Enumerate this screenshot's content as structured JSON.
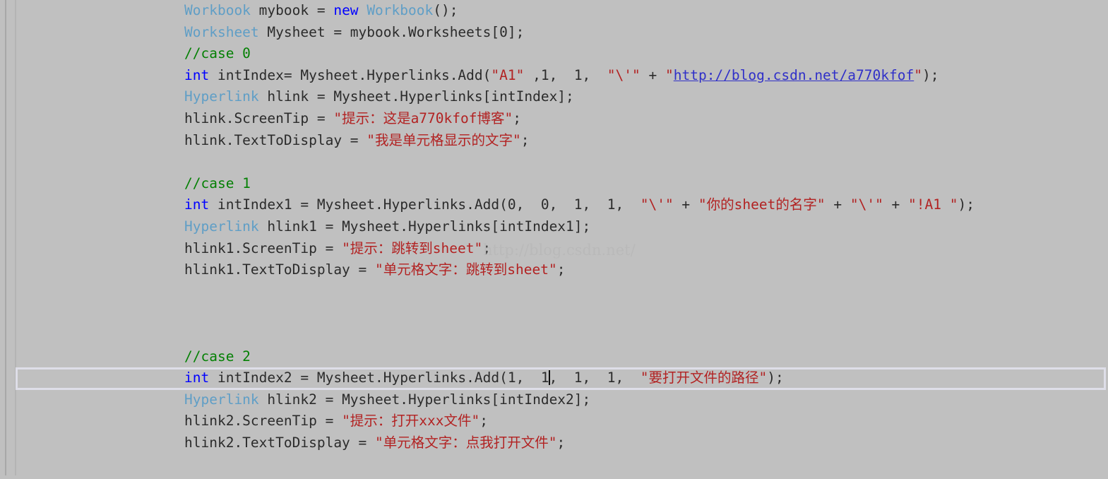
{
  "editor": {
    "background_color": "#c0c0c0",
    "font_size_px": 19.5,
    "watermark": "http://blog.csdn.net/",
    "caret_visible": true,
    "colors": {
      "type": "#5f9ec6",
      "keyword": "#0000ff",
      "comment": "#048004",
      "string": "#b22222",
      "plain": "#2b2b2b",
      "hyperlink": "#3030c8",
      "highlight_border": "#dedee8"
    }
  },
  "code": {
    "lines": [
      {
        "id": 1,
        "text": "Workbook mybook = new Workbook();",
        "tokens": [
          {
            "t": "Workbook",
            "c": "type"
          },
          {
            "t": " mybook = ",
            "c": "plain"
          },
          {
            "t": "new",
            "c": "keyword"
          },
          {
            "t": " ",
            "c": "plain"
          },
          {
            "t": "Workbook",
            "c": "type"
          },
          {
            "t": "();",
            "c": "plain"
          }
        ]
      },
      {
        "id": 2,
        "text": "Worksheet Mysheet = mybook.Worksheets[0];",
        "tokens": [
          {
            "t": "Worksheet",
            "c": "type"
          },
          {
            "t": " Mysheet = mybook.Worksheets[0];",
            "c": "plain"
          }
        ]
      },
      {
        "id": 3,
        "text": "//case 0",
        "tokens": [
          {
            "t": "//case 0",
            "c": "comment"
          }
        ]
      },
      {
        "id": 4,
        "text": "int intIndex= Mysheet.Hyperlinks.Add(\"A1\" ,1, 1, \"\\'\" + \"http://blog.csdn.net/a770kfof\");",
        "tokens": [
          {
            "t": "int",
            "c": "keyword"
          },
          {
            "t": " intIndex= Mysheet.Hyperlinks.Add(",
            "c": "plain"
          },
          {
            "t": "\"A1\"",
            "c": "string"
          },
          {
            "t": " ,1,  1,  ",
            "c": "plain"
          },
          {
            "t": "\"\\'\"",
            "c": "string"
          },
          {
            "t": " + ",
            "c": "plain"
          },
          {
            "t": "\"",
            "c": "string"
          },
          {
            "t": "http://blog.csdn.net/a770kfof",
            "c": "hyperlink"
          },
          {
            "t": "\"",
            "c": "string"
          },
          {
            "t": ");",
            "c": "plain"
          }
        ]
      },
      {
        "id": 5,
        "text": "Hyperlink hlink = Mysheet.Hyperlinks[intIndex];",
        "tokens": [
          {
            "t": "Hyperlink",
            "c": "type"
          },
          {
            "t": " hlink = Mysheet.Hyperlinks[intIndex];",
            "c": "plain"
          }
        ]
      },
      {
        "id": 6,
        "text": "hlink.ScreenTip = \"提示：这是a770kfof博客\";",
        "tokens": [
          {
            "t": "hlink.ScreenTip = ",
            "c": "plain"
          },
          {
            "t": "\"提示：这是a770kfof博客\"",
            "c": "string"
          },
          {
            "t": ";",
            "c": "plain"
          }
        ]
      },
      {
        "id": 7,
        "text": "hlink.TextToDisplay = \"我是单元格显示的文字\";",
        "tokens": [
          {
            "t": "hlink.TextToDisplay = ",
            "c": "plain"
          },
          {
            "t": "\"我是单元格显示的文字\"",
            "c": "string"
          },
          {
            "t": ";",
            "c": "plain"
          }
        ]
      },
      {
        "id": 8,
        "text": "",
        "tokens": []
      },
      {
        "id": 9,
        "text": "//case 1",
        "tokens": [
          {
            "t": "//case 1",
            "c": "comment"
          }
        ]
      },
      {
        "id": 10,
        "text": "int intIndex1 = Mysheet.Hyperlinks.Add(0, 0, 1, 1, \"\\'\" + \"你的sheet的名字\" + \"\\'\" + \"!A1 \");",
        "tokens": [
          {
            "t": "int",
            "c": "keyword"
          },
          {
            "t": " intIndex1 = Mysheet.Hyperlinks.Add(0,  0,  1,  1,  ",
            "c": "plain"
          },
          {
            "t": "\"\\'\"",
            "c": "string"
          },
          {
            "t": " + ",
            "c": "plain"
          },
          {
            "t": "\"你的sheet的名字\"",
            "c": "string"
          },
          {
            "t": " + ",
            "c": "plain"
          },
          {
            "t": "\"\\'\"",
            "c": "string"
          },
          {
            "t": " + ",
            "c": "plain"
          },
          {
            "t": "\"!A1 \"",
            "c": "string"
          },
          {
            "t": ");",
            "c": "plain"
          }
        ]
      },
      {
        "id": 11,
        "text": "Hyperlink hlink1 = Mysheet.Hyperlinks[intIndex1];",
        "tokens": [
          {
            "t": "Hyperlink",
            "c": "type"
          },
          {
            "t": " hlink1 = Mysheet.Hyperlinks[intIndex1];",
            "c": "plain"
          }
        ]
      },
      {
        "id": 12,
        "text": "hlink1.ScreenTip = \"提示：跳转到sheet\";",
        "tokens": [
          {
            "t": "hlink1.ScreenTip = ",
            "c": "plain"
          },
          {
            "t": "\"提示：跳转到sheet\"",
            "c": "string"
          },
          {
            "t": ";",
            "c": "plain"
          }
        ]
      },
      {
        "id": 13,
        "text": "hlink1.TextToDisplay = \"单元格文字：跳转到sheet\";",
        "tokens": [
          {
            "t": "hlink1.TextToDisplay = ",
            "c": "plain"
          },
          {
            "t": "\"单元格文字：跳转到sheet\"",
            "c": "string"
          },
          {
            "t": ";",
            "c": "plain"
          }
        ]
      },
      {
        "id": 14,
        "text": "",
        "tokens": []
      },
      {
        "id": 15,
        "text": "",
        "tokens": []
      },
      {
        "id": 16,
        "text": "",
        "tokens": []
      },
      {
        "id": 17,
        "text": "//case 2",
        "tokens": [
          {
            "t": "//case 2",
            "c": "comment"
          }
        ]
      },
      {
        "id": 18,
        "current": true,
        "text": "int intIndex2 = Mysheet.Hyperlinks.Add(1, 1, 1, 1, \"要打开文件的路径\");",
        "tokens": [
          {
            "t": "int",
            "c": "keyword"
          },
          {
            "t": " intIndex2 = Mysheet.Hyperlinks.Add(1,  1",
            "c": "plain"
          },
          {
            "t": "|CARET|",
            "c": "caret"
          },
          {
            "t": ",  1,  1,  ",
            "c": "plain"
          },
          {
            "t": "\"要打开文件的路径\"",
            "c": "string"
          },
          {
            "t": ");",
            "c": "plain"
          }
        ]
      },
      {
        "id": 19,
        "text": "Hyperlink hlink2 = Mysheet.Hyperlinks[intIndex2];",
        "tokens": [
          {
            "t": "Hyperlink",
            "c": "type"
          },
          {
            "t": " hlink2 = Mysheet.Hyperlinks[intIndex2];",
            "c": "plain"
          }
        ]
      },
      {
        "id": 20,
        "text": "hlink2.ScreenTip = \"提示：打开xxx文件\";",
        "tokens": [
          {
            "t": "hlink2.ScreenTip = ",
            "c": "plain"
          },
          {
            "t": "\"提示：打开xxx文件\"",
            "c": "string"
          },
          {
            "t": ";",
            "c": "plain"
          }
        ]
      },
      {
        "id": 21,
        "text": "hlink2.TextToDisplay = \"单元格文字：点我打开文件\";",
        "tokens": [
          {
            "t": "hlink2.TextToDisplay = ",
            "c": "plain"
          },
          {
            "t": "\"单元格文字：点我打开文件\"",
            "c": "string"
          },
          {
            "t": ";",
            "c": "plain"
          }
        ]
      }
    ]
  }
}
